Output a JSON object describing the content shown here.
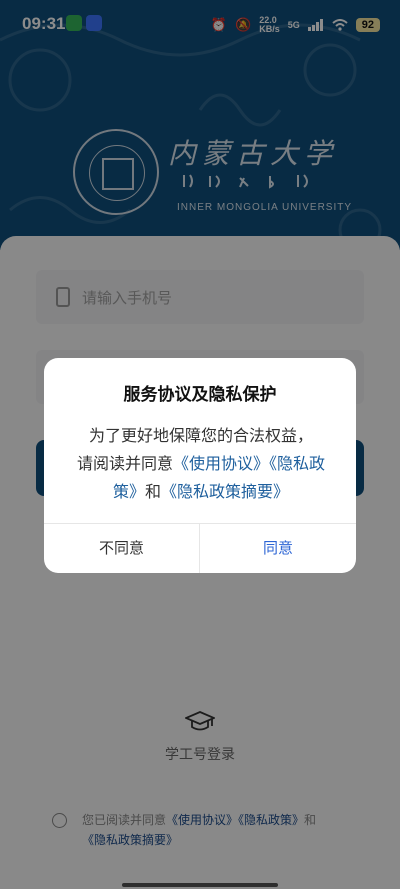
{
  "status_bar": {
    "time": "09:31",
    "net_speed": "22.0\nKB/s",
    "network": "5G",
    "battery": "92"
  },
  "header": {
    "university_cn": "内蒙古大学",
    "university_en": "INNER MONGOLIA UNIVERSITY",
    "logo_ring_text": "INNER MONGOLIA UNIVERSITY"
  },
  "login": {
    "phone_placeholder": "请输入手机号",
    "staff_login_label": "学工号登录",
    "agreement_prefix": "您已阅读并同意",
    "agreement_link_terms": "《使用协议》",
    "agreement_link_privacy": "《隐私政策》",
    "agreement_and": "和",
    "agreement_link_summary": "《隐私政策摘要》"
  },
  "dialog": {
    "title": "服务协议及隐私保护",
    "body_line1": "为了更好地保障您的合法权益，",
    "body_prefix": "请阅读并同意",
    "link_terms": "《使用协议》",
    "link_privacy": "《隐私政策》",
    "body_and": "和",
    "link_summary": "《隐私政策摘要》",
    "decline_label": "不同意",
    "agree_label": "同意"
  },
  "colors": {
    "brand": "#0f4f7d",
    "link": "#1e5f9d",
    "agree": "#2b64d4"
  }
}
